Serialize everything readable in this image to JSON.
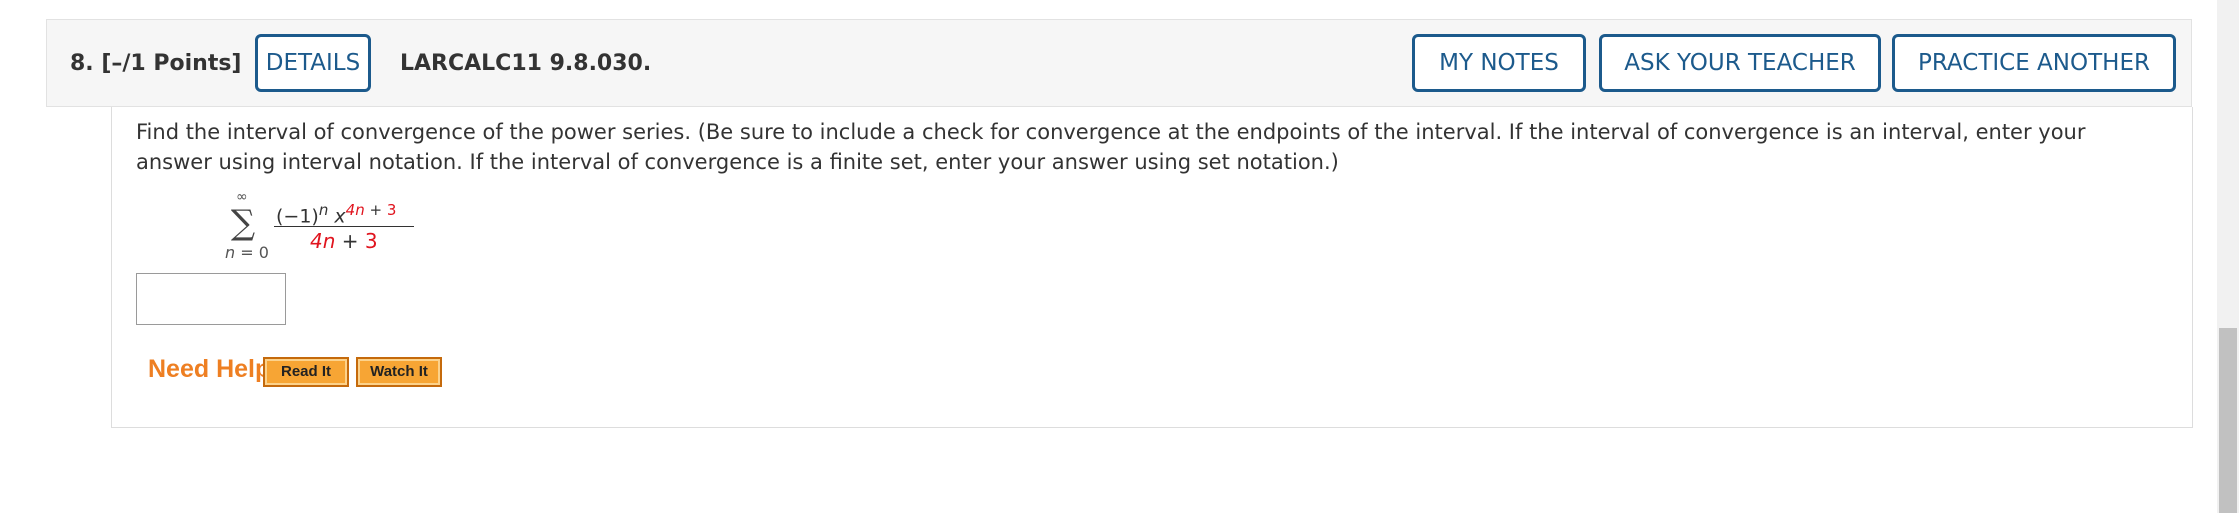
{
  "header": {
    "question_label": "8.  [–/1 Points]",
    "details_label": "DETAILS",
    "problem_code": "LARCALC11 9.8.030.",
    "my_notes_label": "MY NOTES",
    "ask_teacher_label": "ASK YOUR TEACHER",
    "practice_another_label": "PRACTICE ANOTHER"
  },
  "question": {
    "instructions": "Find the interval of convergence of the power series. (Be sure to include a check for convergence at the endpoints of the interval. If the interval of convergence is an interval, enter your answer using interval notation. If the interval of convergence is a finite set, enter your answer using set notation.)",
    "series": {
      "sigma": "∑",
      "upper_limit": "∞",
      "lower_var": "n",
      "lower_eq": " = 0",
      "num_base": "(−1)",
      "num_sign_exp": "n",
      "num_var": "x",
      "num_exp_var": "4n",
      "num_exp_plus": " + ",
      "num_exp_const": "3",
      "den_var": "4n",
      "den_plus": " + ",
      "den_const": "3"
    },
    "answer_value": ""
  },
  "help": {
    "need_help_label": "Need Help?",
    "read_it_label": "Read It",
    "watch_it_label": "Watch It"
  },
  "colors": {
    "accent": "#1c5a8c",
    "highlight": "#e0141e",
    "help_orange": "#ee7f22"
  }
}
